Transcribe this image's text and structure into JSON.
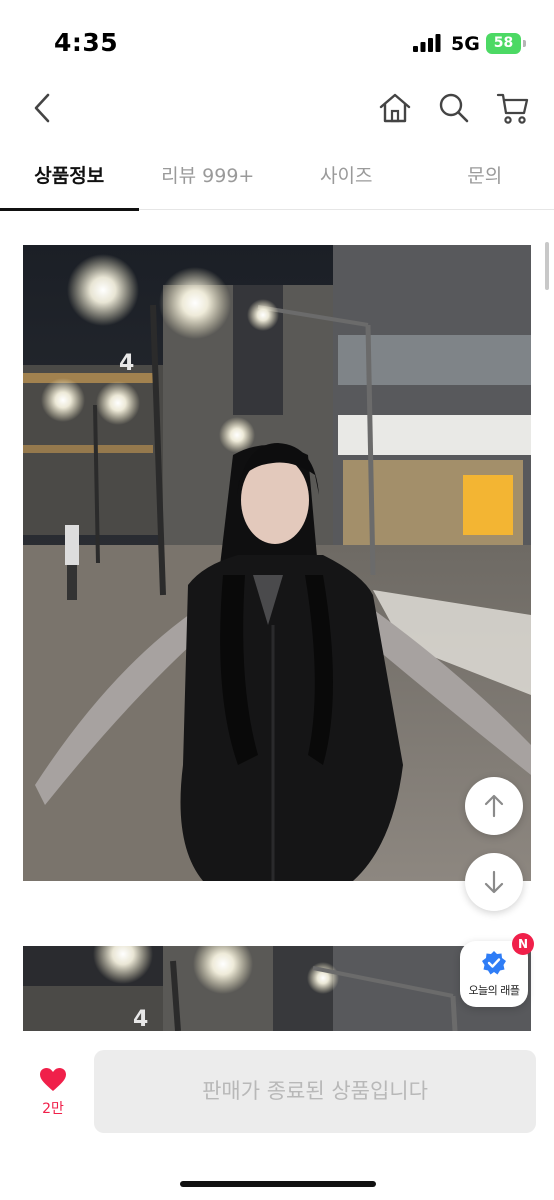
{
  "status_bar": {
    "time": "4:35",
    "network": "5G",
    "battery": "58"
  },
  "nav": {
    "back_icon": "chevron-left-icon",
    "home_icon": "home-icon",
    "search_icon": "search-icon",
    "cart_icon": "cart-icon"
  },
  "tabs": [
    {
      "label": "상품정보",
      "active": true
    },
    {
      "label": "리뷰 999+",
      "active": false
    },
    {
      "label": "사이즈",
      "active": false
    },
    {
      "label": "문의",
      "active": false
    }
  ],
  "floating": {
    "scroll_up_icon": "arrow-up-icon",
    "scroll_down_icon": "arrow-down-icon",
    "raffle_label": "오늘의 래플",
    "raffle_badge": "N"
  },
  "bottom_bar": {
    "like_count": "2만",
    "purchase_label": "판매가 종료된 상품입니다"
  },
  "colors": {
    "accent": "#f0204a",
    "verified": "#2f7df6",
    "battery": "#4cd964"
  }
}
